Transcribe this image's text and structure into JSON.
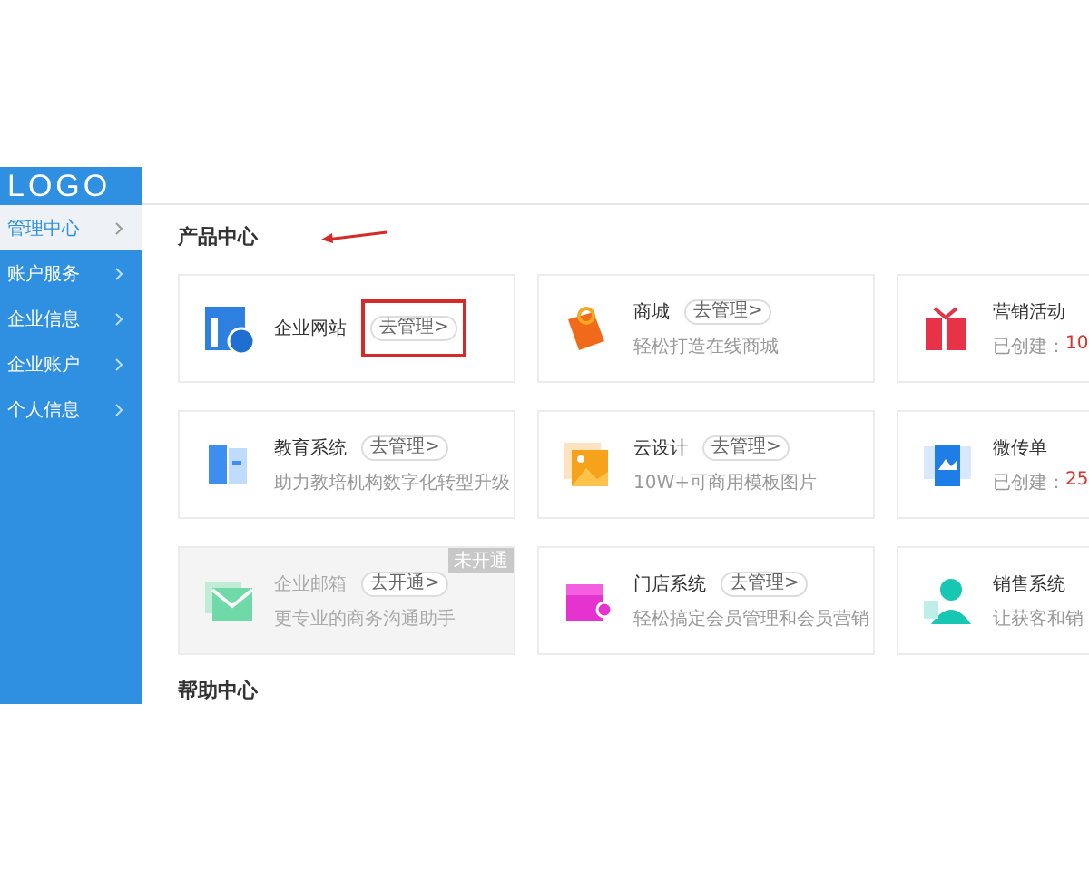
{
  "sidebar": {
    "logo": "LOGO",
    "items": [
      {
        "label": "管理中心",
        "selected": true
      },
      {
        "label": "账户服务",
        "selected": false
      },
      {
        "label": "企业信息",
        "selected": false
      },
      {
        "label": "企业账户",
        "selected": false
      },
      {
        "label": "个人信息",
        "selected": false
      }
    ]
  },
  "section_title": "产品中心",
  "products": [
    {
      "kind": "manage",
      "name": "企业网站",
      "button": "去管理>",
      "highlighted": true,
      "disabled": false
    },
    {
      "kind": "manage",
      "name": "商城",
      "button": "去管理>",
      "description": "轻松打造在线商城",
      "disabled": false
    },
    {
      "kind": "stat",
      "name": "营销活动",
      "stat_label": "已创建：",
      "count": "10",
      "disabled": false
    },
    {
      "kind": "manage",
      "name": "教育系统",
      "button": "去管理>",
      "description": "助力教培机构数字化转型升级",
      "disabled": false
    },
    {
      "kind": "manage",
      "name": "云设计",
      "button": "去管理>",
      "description": "10W+可商用模板图片",
      "disabled": false
    },
    {
      "kind": "stat",
      "name": "微传单",
      "stat_label": "已创建：",
      "count": "25",
      "disabled": false
    },
    {
      "kind": "manage",
      "name": "企业邮箱",
      "button": "去开通>",
      "description": "更专业的商务沟通助手",
      "disabled": true,
      "badge": "未开通"
    },
    {
      "kind": "manage",
      "name": "门店系统",
      "button": "去管理>",
      "description": "轻松搞定会员管理和会员营销",
      "disabled": false
    },
    {
      "kind": "manage",
      "name": "销售系统",
      "description": "让获客和销",
      "disabled": false
    }
  ],
  "next_section_title": "帮助中心"
}
